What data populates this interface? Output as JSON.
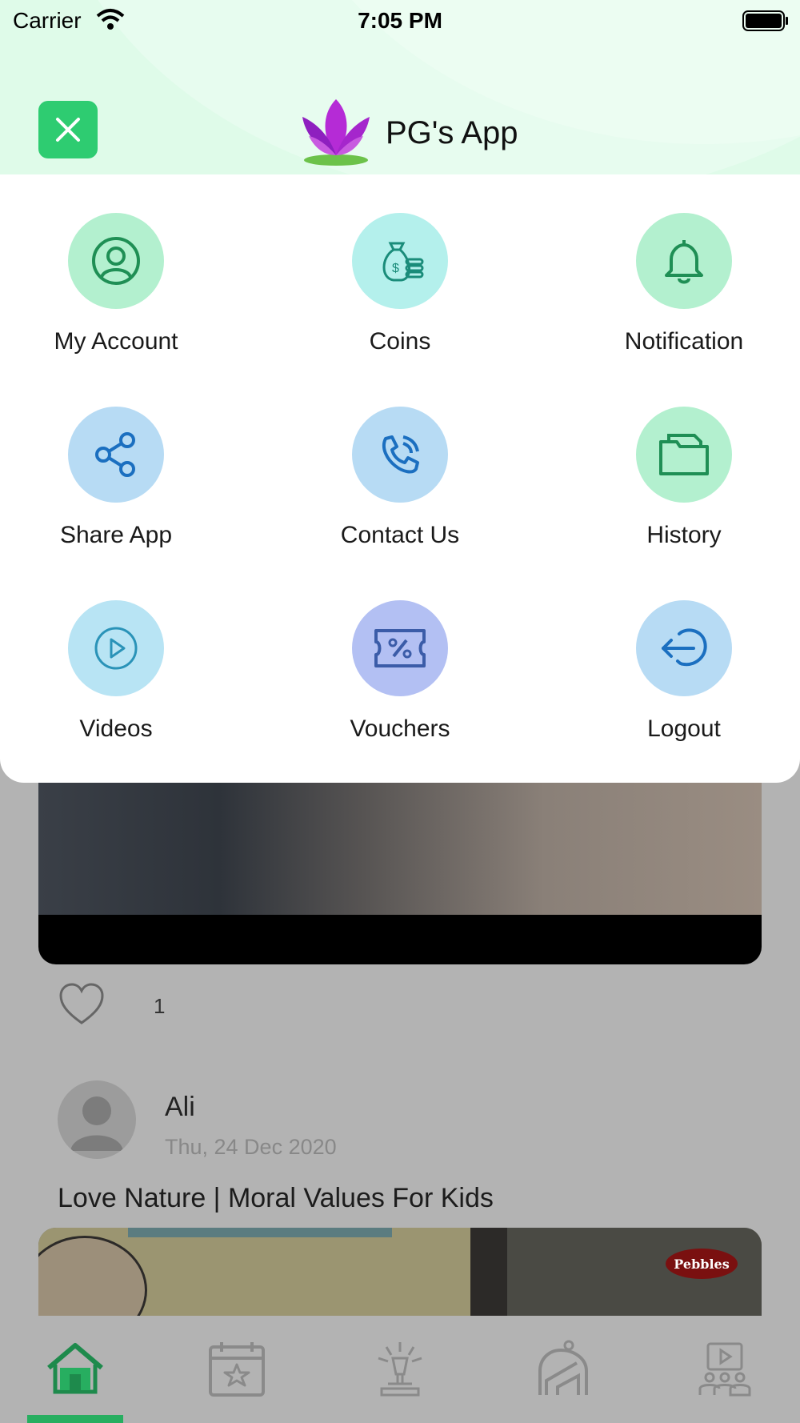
{
  "status_bar": {
    "carrier": "Carrier",
    "time": "7:05 PM"
  },
  "header": {
    "title": "PG's App"
  },
  "menu": {
    "items": [
      {
        "label": "My Account",
        "icon": "user-circle-icon",
        "color": "#b3f0cf"
      },
      {
        "label": "Coins",
        "icon": "money-bag-icon",
        "color": "#b4f0ec"
      },
      {
        "label": "Notification",
        "icon": "bell-icon",
        "color": "#b3f0cf"
      },
      {
        "label": "Share App",
        "icon": "share-icon",
        "color": "#b7dbf4"
      },
      {
        "label": "Contact Us",
        "icon": "phone-icon",
        "color": "#b7dbf4"
      },
      {
        "label": "History",
        "icon": "folder-icon",
        "color": "#b3f0cf"
      },
      {
        "label": "Videos",
        "icon": "play-icon",
        "color": "#b8e4f4"
      },
      {
        "label": "Vouchers",
        "icon": "voucher-icon",
        "color": "#b3c0f3"
      },
      {
        "label": "Logout",
        "icon": "logout-icon",
        "color": "#b7dbf4"
      }
    ]
  },
  "feed": {
    "like_count": "1",
    "post": {
      "author": "Ali",
      "date": "Thu, 24 Dec 2020",
      "title": "Love Nature | Moral Values For Kids",
      "thumbnail_brand": "Pebbles"
    }
  },
  "tabs": [
    {
      "name": "home-icon",
      "active": true
    },
    {
      "name": "calendar-star-icon",
      "active": false
    },
    {
      "name": "event-icon",
      "active": false
    },
    {
      "name": "playground-icon",
      "active": false
    },
    {
      "name": "video-class-icon",
      "active": false
    }
  ],
  "colors": {
    "accent": "#27ae60",
    "close_button": "#2ecc71",
    "header_bg": "#dffbe9"
  }
}
